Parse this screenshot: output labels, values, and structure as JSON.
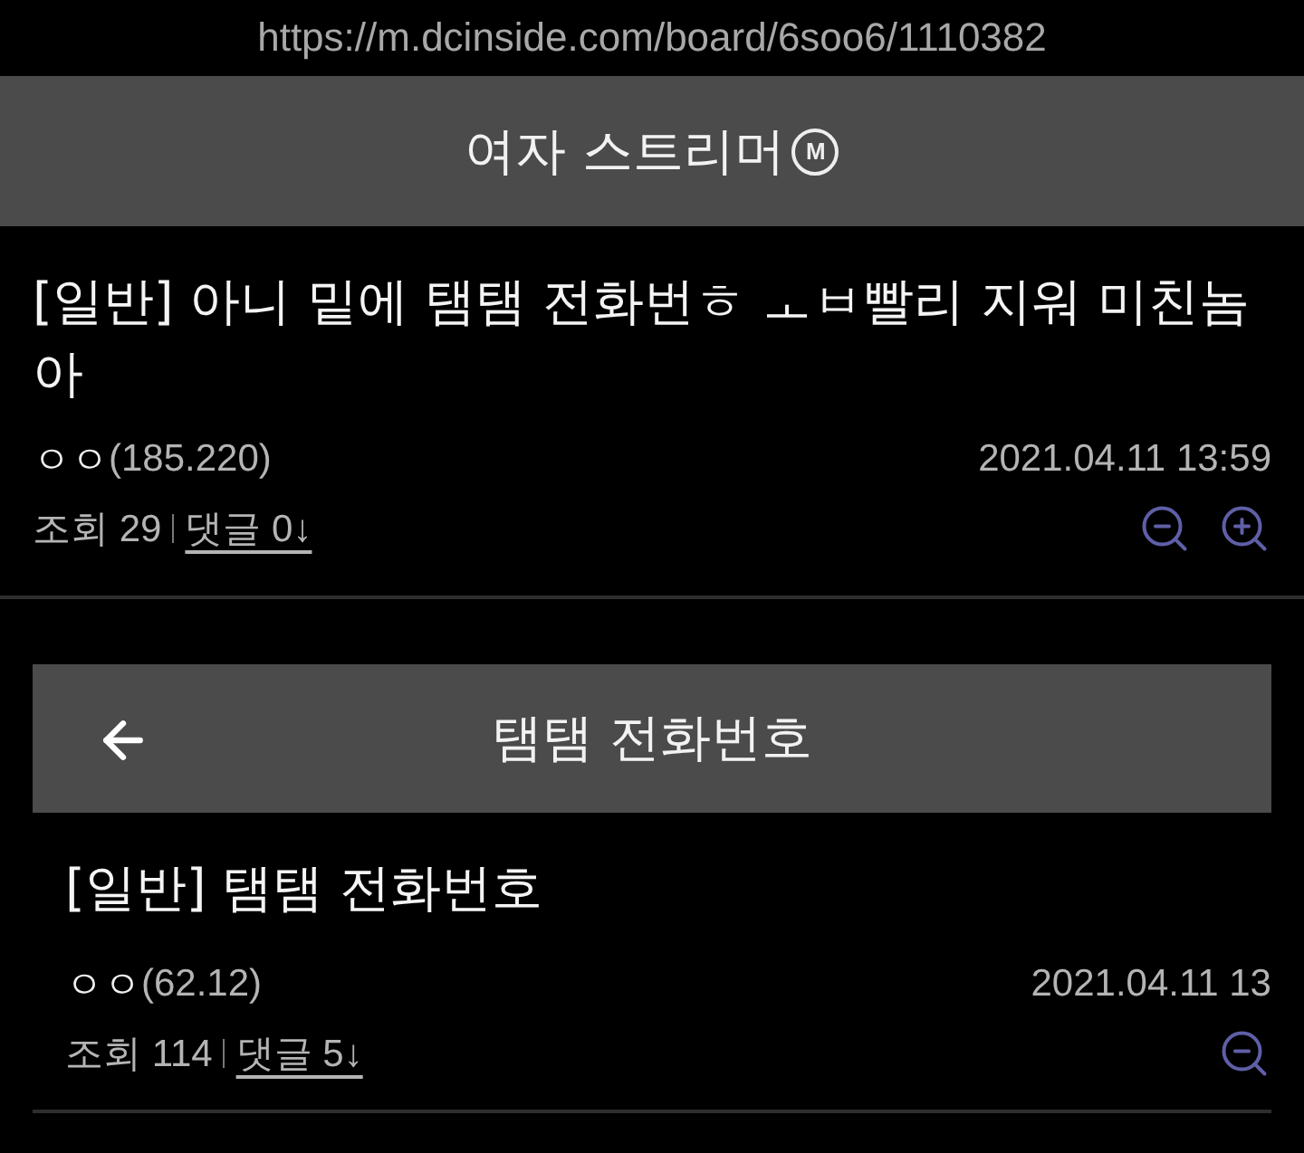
{
  "url": "https://m.dcinside.com/board/6soo6/1110382",
  "header": {
    "title": "여자 스트리머",
    "badge": "M"
  },
  "post": {
    "title": "[일반] 아니 밑에 탬탬 전화번ㅎ ㅗㅂ빨리 지워 미친놈아",
    "writer": "ㅇㅇ",
    "ip": "(185.220)",
    "date": "2021.04.11 13:59",
    "views": "조회 29",
    "comments": "댓글 0↓",
    "zoom_buttons": [
      {
        "kind": "zoom_out"
      },
      {
        "kind": "zoom_in"
      }
    ]
  },
  "embedded": {
    "header": {
      "title": "탬탬 전화번호"
    },
    "post": {
      "title": "[일반] 탬탬 전화번호",
      "writer": "ㅇㅇ",
      "ip": "(62.12)",
      "date": "2021.04.11 13",
      "views": "조회 114",
      "comments": "댓글 5↓",
      "zoom_buttons": [
        {
          "kind": "zoom_out"
        }
      ]
    }
  }
}
